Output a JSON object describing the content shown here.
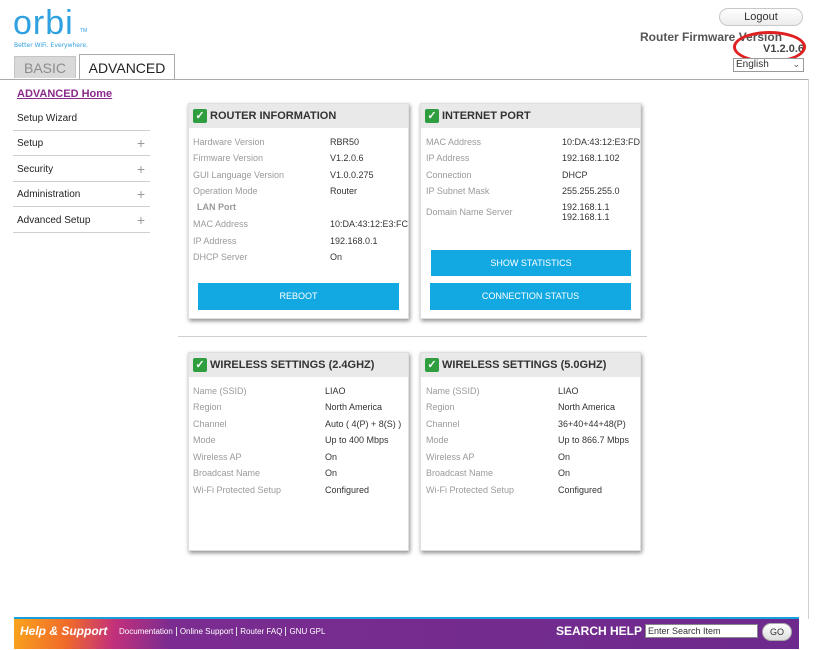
{
  "header": {
    "logo": "orbi",
    "logo_tm": "TM",
    "tagline": "Better WiFi. Everywhere.",
    "logout_label": "Logout",
    "fw_label": "Router Firmware Version",
    "fw_value": "V1.2.0.6",
    "language": "English"
  },
  "tabs": {
    "basic": "BASIC",
    "advanced": "ADVANCED"
  },
  "sidebar": {
    "home": "ADVANCED Home",
    "items": [
      {
        "label": "Setup Wizard"
      },
      {
        "label": "Setup"
      },
      {
        "label": "Security"
      },
      {
        "label": "Administration"
      },
      {
        "label": "Advanced Setup"
      }
    ],
    "expand": "+"
  },
  "router": {
    "title": "ROUTER INFORMATION",
    "rows": [
      {
        "label": "Hardware Version",
        "value": "RBR50"
      },
      {
        "label": "Firmware Version",
        "value": "V1.2.0.6"
      },
      {
        "label": "GUI Language Version",
        "value": "V1.0.0.275"
      },
      {
        "label": "Operation Mode",
        "value": "Router"
      }
    ],
    "lan_heading": "LAN Port",
    "lan_rows": [
      {
        "label": "MAC Address",
        "value": "10:DA:43:12:E3:FC"
      },
      {
        "label": "IP Address",
        "value": "192.168.0.1"
      },
      {
        "label": "DHCP Server",
        "value": "On"
      }
    ],
    "reboot": "REBOOT"
  },
  "internet": {
    "title": "INTERNET PORT",
    "rows": [
      {
        "label": "MAC Address",
        "value": "10:DA:43:12:E3:FD"
      },
      {
        "label": "IP Address",
        "value": "192.168.1.102"
      },
      {
        "label": "Connection",
        "value": "DHCP"
      },
      {
        "label": "IP Subnet Mask",
        "value": "255.255.255.0"
      }
    ],
    "dns_label": "Domain Name Server",
    "dns_values": [
      "192.168.1.1",
      "192.168.1.1"
    ],
    "show_stats": "SHOW STATISTICS",
    "conn_status": "CONNECTION STATUS"
  },
  "wifi24": {
    "title": "WIRELESS SETTINGS (2.4GHZ)",
    "rows": [
      {
        "label": "Name (SSID)",
        "value": "LIAO"
      },
      {
        "label": "Region",
        "value": "North America"
      },
      {
        "label": "Channel",
        "value": "Auto ( 4(P) + 8(S) )"
      },
      {
        "label": "Mode",
        "value": "Up to 400 Mbps"
      },
      {
        "label": "Wireless AP",
        "value": "On"
      },
      {
        "label": "Broadcast Name",
        "value": "On"
      },
      {
        "label": "Wi-Fi Protected Setup",
        "value": "Configured"
      }
    ]
  },
  "wifi5": {
    "title": "WIRELESS SETTINGS (5.0GHZ)",
    "rows": [
      {
        "label": "Name (SSID)",
        "value": "LIAO"
      },
      {
        "label": "Region",
        "value": "North America"
      },
      {
        "label": "Channel",
        "value": "36+40+44+48(P)"
      },
      {
        "label": "Mode",
        "value": "Up to 866.7 Mbps"
      },
      {
        "label": "Wireless AP",
        "value": "On"
      },
      {
        "label": "Broadcast Name",
        "value": "On"
      },
      {
        "label": "Wi-Fi Protected Setup",
        "value": "Configured"
      }
    ]
  },
  "footer": {
    "help_title": "Help & Support",
    "links": [
      "Documentation",
      "Online Support",
      "Router FAQ",
      "GNU GPL"
    ],
    "search_label": "SEARCH HELP",
    "search_placeholder": "Enter Search Item",
    "go": "GO"
  }
}
